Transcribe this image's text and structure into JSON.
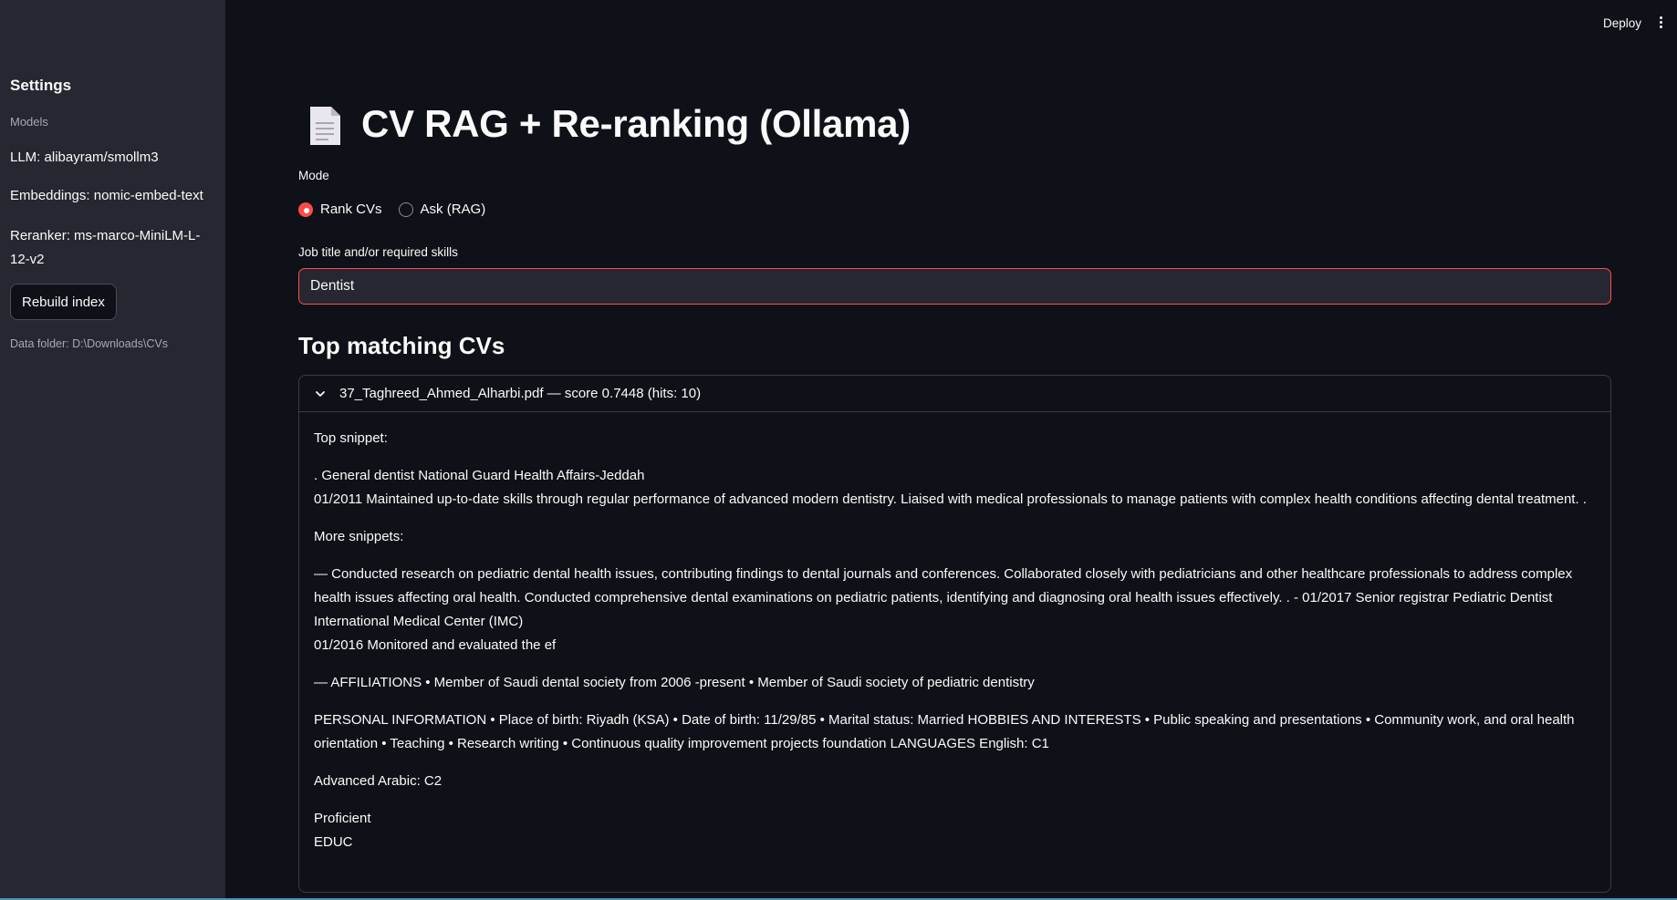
{
  "sidebar": {
    "title": "Settings",
    "models_label": "Models",
    "llm": "LLM: alibayram/smollm3",
    "embeddings": "Embeddings: nomic-embed-text",
    "reranker": "Reranker: ms-marco-MiniLM-L-12-v2",
    "rebuild_label": "Rebuild index",
    "data_folder": "Data folder: D:\\Downloads\\CVs"
  },
  "header": {
    "deploy_label": "Deploy",
    "menu_icon": "kebab-menu-icon"
  },
  "main": {
    "title_icon": "page-document-icon",
    "title": "CV RAG + Re-ranking (Ollama)",
    "mode_label": "Mode",
    "mode_options": [
      "Rank CVs",
      "Ask (RAG)"
    ],
    "mode_selected": "Rank CVs",
    "job_label": "Job title and/or required skills",
    "job_value": "Dentist",
    "section_title": "Top matching CVs",
    "accent_color": "#ff4b4b",
    "result": {
      "header": "37_Taghreed_Ahmed_Alharbi.pdf — score 0.7448 (hits: 10)",
      "top_snippet_label": "Top snippet:",
      "top_snippet_line1": ". General dentist National Guard Health Affairs-Jeddah",
      "top_snippet_line2": "01/2011 Maintained up-to-date skills through regular performance of advanced modern dentistry. Liaised with medical professionals to manage patients with complex health conditions affecting dental treatment. .",
      "more_snippets_label": "More snippets:",
      "snippet1_a": "— Conducted research on pediatric dental health issues, contributing findings to dental journals and conferences. Collaborated closely with pediatricians and other healthcare professionals to address complex health issues affecting oral health. Conducted comprehensive dental examinations on pediatric patients, identifying and diagnosing oral health issues effectively. . - 01/2017 Senior registrar Pediatric Dentist International Medical Center (IMC)",
      "snippet1_b": "01/2016 Monitored and evaluated the ef",
      "snippet2": "— AFFILIATIONS • Member of Saudi dental society from 2006 -present • Member of Saudi society of pediatric dentistry",
      "snippet3": "PERSONAL INFORMATION • Place of birth: Riyadh (KSA) • Date of birth: 11/29/85 • Marital status: Married HOBBIES AND INTERESTS • Public speaking and presentations • Community work, and oral health orientation • Teaching • Research writing • Continuous quality improvement projects foundation LANGUAGES English: C1",
      "snippet4": "Advanced Arabic: C2",
      "snippet5_a": "Proficient",
      "snippet5_b": "EDUC"
    }
  }
}
